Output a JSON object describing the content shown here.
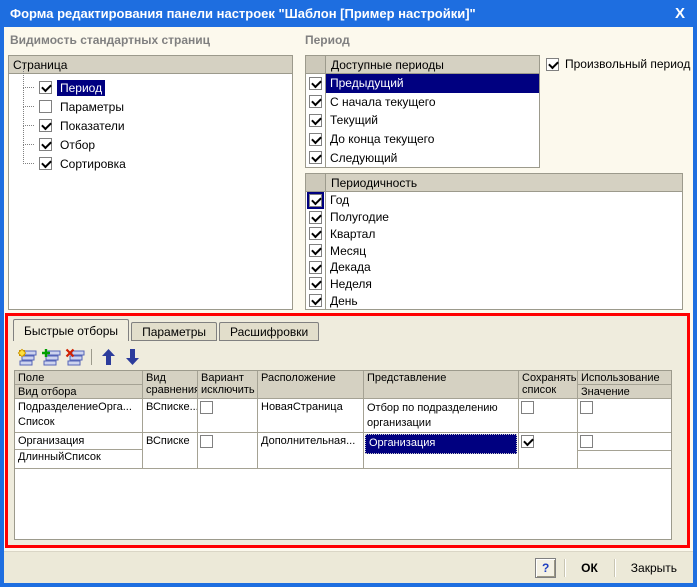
{
  "colors": {
    "titlebar": "#1E6EE0",
    "selection": "#000080",
    "highlight_border": "#FF0000",
    "panel": "#EFECDD"
  },
  "window": {
    "title": "Форма редактирования панели настроек \"Шаблон [Пример настройки]\"",
    "close": "X"
  },
  "sections": {
    "visibility_label": "Видимость стандартных страниц",
    "period_label": "Период"
  },
  "pages_tree": {
    "header": "Страница",
    "items": [
      {
        "label": "Период",
        "checked": true,
        "selected": true
      },
      {
        "label": "Параметры",
        "checked": false,
        "selected": false
      },
      {
        "label": "Показатели",
        "checked": true,
        "selected": false
      },
      {
        "label": "Отбор",
        "checked": true,
        "selected": false
      },
      {
        "label": "Сортировка",
        "checked": true,
        "selected": false
      }
    ]
  },
  "available_periods": {
    "header": "Доступные периоды",
    "items": [
      {
        "label": "Предыдущий",
        "checked": true,
        "selected": true
      },
      {
        "label": "С начала текущего",
        "checked": true,
        "selected": false
      },
      {
        "label": "Текущий",
        "checked": true,
        "selected": false
      },
      {
        "label": "До конца текущего",
        "checked": true,
        "selected": false
      },
      {
        "label": "Следующий",
        "checked": true,
        "selected": false
      }
    ]
  },
  "arbitrary_period": {
    "label": "Произвольный период",
    "checked": true
  },
  "periodicity": {
    "header": "Периодичность",
    "items": [
      {
        "label": "Год",
        "checked": true,
        "focused": true
      },
      {
        "label": "Полугодие",
        "checked": true,
        "focused": false
      },
      {
        "label": "Квартал",
        "checked": true,
        "focused": false
      },
      {
        "label": "Месяц",
        "checked": true,
        "focused": false
      },
      {
        "label": "Декада",
        "checked": true,
        "focused": false
      },
      {
        "label": "Неделя",
        "checked": true,
        "focused": false
      },
      {
        "label": "День",
        "checked": true,
        "focused": false
      }
    ]
  },
  "filters_panel": {
    "tabs": [
      {
        "label": "Быстрые отборы",
        "active": true
      },
      {
        "label": "Параметры",
        "active": false
      },
      {
        "label": "Расшифровки",
        "active": false
      }
    ],
    "toolbar_icons": [
      "add-list-item-icon",
      "insert-list-item-icon",
      "delete-list-item-icon",
      "move-up-icon",
      "move-down-icon"
    ],
    "table": {
      "headers": {
        "field": "Поле",
        "filter_kind": "Вид отбора",
        "comparison": "Вид сравнения",
        "exclude": "Вариант исключить",
        "location": "Расположение",
        "presentation": "Представление",
        "save_list": "Сохранять список",
        "usage": "Использование",
        "value": "Значение"
      },
      "rows": [
        {
          "field": "ПодразделениеОрга...",
          "filter_kind": "Список",
          "comparison": "ВСписке...",
          "exclude": false,
          "location": "НоваяСтраница",
          "presentation": "Отбор по подразделению организации",
          "presentation_selected": false,
          "save_list": false,
          "use_value": false
        },
        {
          "field": "Организация",
          "filter_kind": "ДлинныйСписок",
          "comparison": "ВСписке",
          "exclude": false,
          "location": "Дополнительная...",
          "presentation": "Организация",
          "presentation_selected": true,
          "save_list": true,
          "use_value": false
        }
      ]
    }
  },
  "footer": {
    "help": "?",
    "ok": "ОК",
    "close": "Закрыть"
  }
}
